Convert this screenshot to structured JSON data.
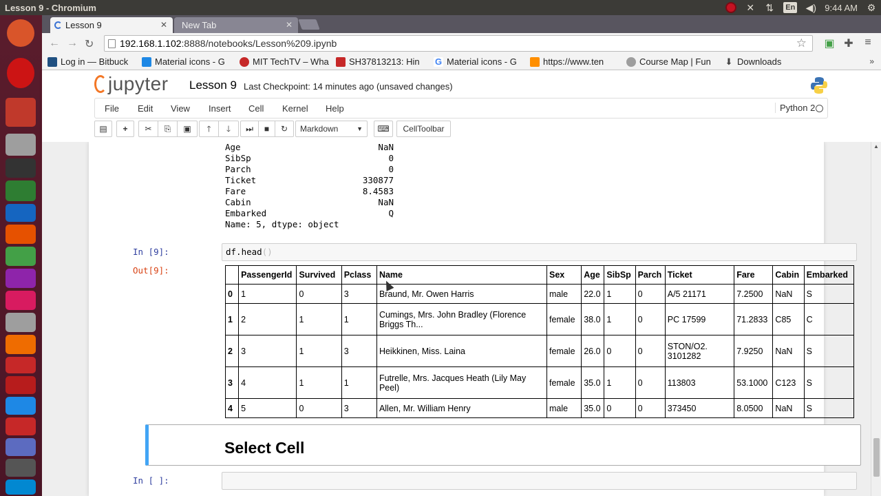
{
  "os": {
    "window_title": "Lesson 9 - Chromium",
    "keyboard": "En",
    "clock": "9:44 AM"
  },
  "browser": {
    "tabs": [
      {
        "label": "Lesson 9",
        "active": true
      },
      {
        "label": "New Tab",
        "active": false
      }
    ],
    "url_host": "192.168.1.102",
    "url_path": ":8888/notebooks/Lesson%209.ipynb",
    "bookmarks": [
      {
        "label": "Log in — Bitbuck",
        "icon": "bitbucket-icon",
        "color": "#205081"
      },
      {
        "label": "Material icons - G",
        "icon": "material-icons-icon",
        "color": "#1e88e5"
      },
      {
        "label": "MIT TechTV – Wha",
        "icon": "mit-techtv-icon",
        "color": "#c62828"
      },
      {
        "label": "SH37813213: Hin",
        "icon": "shodan-icon",
        "color": "#c62828"
      },
      {
        "label": "Material icons - G",
        "icon": "google-icon",
        "color": "#4285f4"
      },
      {
        "label": "https://www.ten",
        "icon": "tensorflow-icon",
        "color": "#ff8f00"
      },
      {
        "label": "Course Map | Fun",
        "icon": "cloud-icon",
        "color": "#9e9e9e"
      },
      {
        "label": "Downloads",
        "icon": "download-icon",
        "color": "#444444"
      }
    ]
  },
  "jupyter": {
    "brand": "jupyter",
    "notebook_name": "Lesson 9",
    "checkpoint": "Last Checkpoint: 14 minutes ago (unsaved changes)",
    "menus": [
      "File",
      "Edit",
      "View",
      "Insert",
      "Cell",
      "Kernel",
      "Help"
    ],
    "kernel": "Python 2",
    "cell_type": "Markdown",
    "celltoolbar_label": "CellToolbar"
  },
  "series_output": {
    "rows": [
      {
        "key": "Age",
        "value": "NaN"
      },
      {
        "key": "SibSp",
        "value": "0"
      },
      {
        "key": "Parch",
        "value": "0"
      },
      {
        "key": "Ticket",
        "value": "330877"
      },
      {
        "key": "Fare",
        "value": "8.4583"
      },
      {
        "key": "Cabin",
        "value": "NaN"
      },
      {
        "key": "Embarked",
        "value": "Q"
      }
    ],
    "footer": "Name: 5, dtype: object"
  },
  "cell9": {
    "in_prompt": "In [9]:",
    "code": "df.head",
    "code_parens": "()",
    "out_prompt": "Out[9]:"
  },
  "dataframe": {
    "columns": [
      "",
      "PassengerId",
      "Survived",
      "Pclass",
      "Name",
      "Sex",
      "Age",
      "SibSp",
      "Parch",
      "Ticket",
      "Fare",
      "Cabin",
      "Embarked"
    ],
    "rows": [
      [
        "0",
        "1",
        "0",
        "3",
        "Braund, Mr. Owen Harris",
        "male",
        "22.0",
        "1",
        "0",
        "A/5 21171",
        "7.2500",
        "NaN",
        "S"
      ],
      [
        "1",
        "2",
        "1",
        "1",
        "Cumings, Mrs. John Bradley (Florence Briggs Th...",
        "female",
        "38.0",
        "1",
        "0",
        "PC 17599",
        "71.2833",
        "C85",
        "C"
      ],
      [
        "2",
        "3",
        "1",
        "3",
        "Heikkinen, Miss. Laina",
        "female",
        "26.0",
        "0",
        "0",
        "STON/O2. 3101282",
        "7.9250",
        "NaN",
        "S"
      ],
      [
        "3",
        "4",
        "1",
        "1",
        "Futrelle, Mrs. Jacques Heath (Lily May Peel)",
        "female",
        "35.0",
        "1",
        "0",
        "113803",
        "53.1000",
        "C123",
        "S"
      ],
      [
        "4",
        "5",
        "0",
        "3",
        "Allen, Mr. William Henry",
        "male",
        "35.0",
        "0",
        "0",
        "373450",
        "8.0500",
        "NaN",
        "S"
      ]
    ]
  },
  "markdown_cell": {
    "heading": "Select Cell"
  },
  "empty_cell": {
    "in_prompt": "In [ ]:"
  }
}
